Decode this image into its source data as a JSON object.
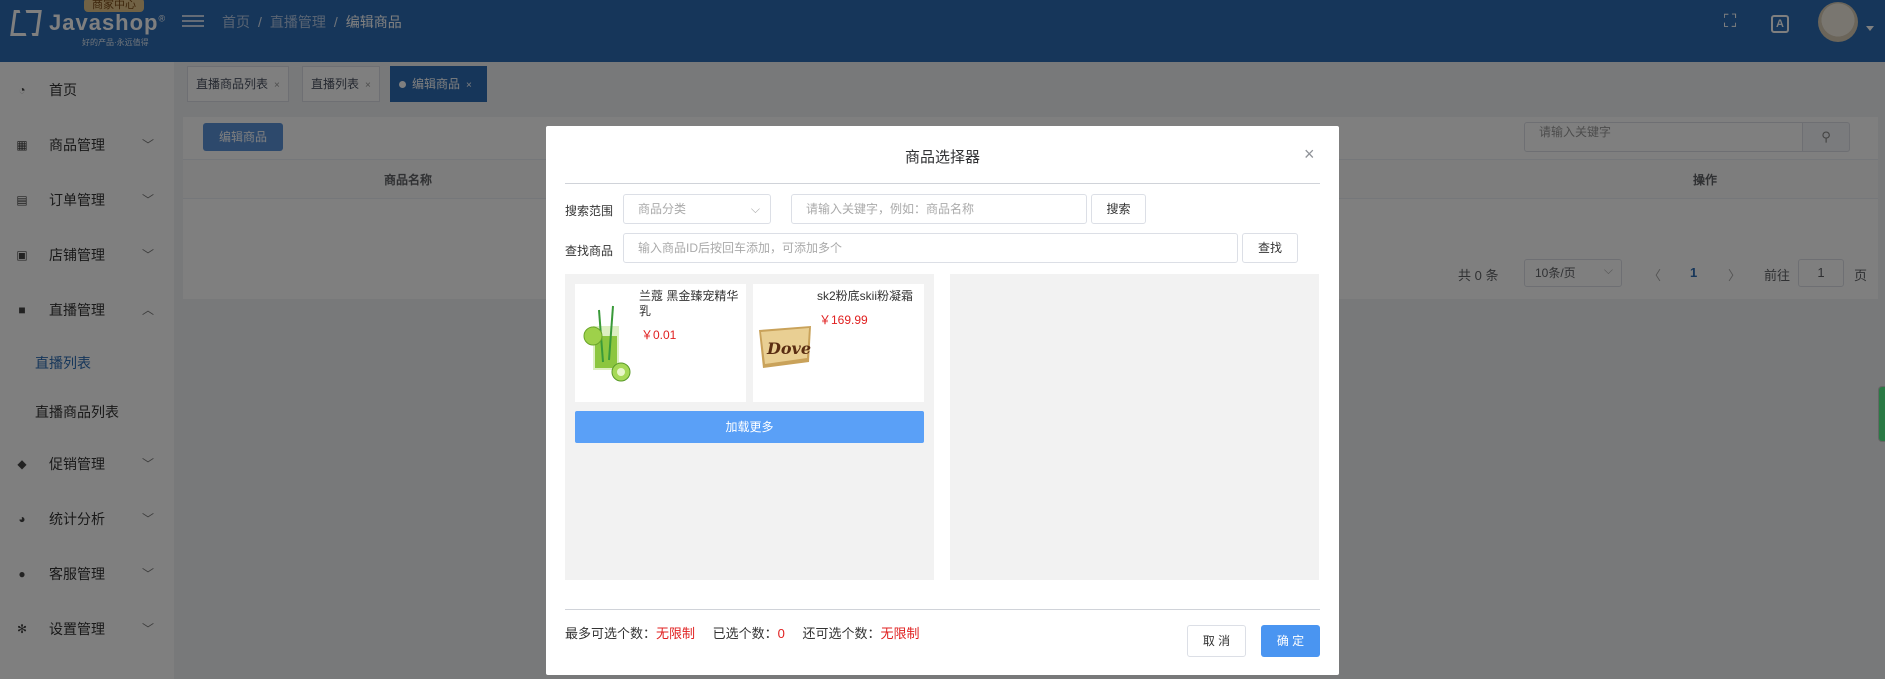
{
  "header": {
    "logo_badge": "商家中心",
    "logo_name": "Javashop",
    "logo_reg": "®",
    "logo_slogan": "好的产品·永远值得",
    "breadcrumb": [
      "首页",
      "直播管理",
      "编辑商品"
    ],
    "icons": [
      "menu-icon",
      "fullscreen-icon",
      "language-icon",
      "avatar"
    ]
  },
  "sidebar": {
    "items": [
      {
        "label": "首页",
        "icon": "dashboard-icon"
      },
      {
        "label": "商品管理",
        "icon": "grid-icon"
      },
      {
        "label": "订单管理",
        "icon": "clipboard-icon"
      },
      {
        "label": "店铺管理",
        "icon": "shop-icon"
      },
      {
        "label": "直播管理",
        "icon": "video-icon"
      },
      {
        "label": "促销管理",
        "icon": "tag-icon"
      },
      {
        "label": "统计分析",
        "icon": "pie-chart-icon"
      },
      {
        "label": "客服管理",
        "icon": "user-icon"
      },
      {
        "label": "设置管理",
        "icon": "gear-icon"
      }
    ],
    "subitems": [
      {
        "label": "直播列表",
        "active": true
      },
      {
        "label": "直播商品列表",
        "active": false
      }
    ]
  },
  "tabs": [
    {
      "label": "直播商品列表",
      "close": "×"
    },
    {
      "label": "直播列表",
      "close": "×"
    },
    {
      "label": "编辑商品",
      "close": "×",
      "active": true
    }
  ],
  "main": {
    "edit_button": "编辑商品",
    "search_placeholder": "请输入关键字",
    "columns": [
      "商品名称",
      "操作"
    ],
    "pager": {
      "total": "共 0 条",
      "page_size": "10条/页",
      "current_page": "1",
      "goto_prefix": "前往",
      "goto_value": "1",
      "goto_suffix": "页"
    }
  },
  "dialog": {
    "title": "商品选择器",
    "close": "×",
    "search_range_label": "搜索范围",
    "category_placeholder": "商品分类",
    "keyword_placeholder": "请输入关键字，例如：商品名称",
    "search_button": "搜索",
    "find_label": "查找商品",
    "find_placeholder": "输入商品ID后按回车添加，可添加多个",
    "find_button": "查找",
    "goods": [
      {
        "name": "兰蔻 黑金臻宠精华乳",
        "price": "￥0.01",
        "image": "mojito-drink-image"
      },
      {
        "name": "sk2粉底skii粉凝霜",
        "price": "￥169.99",
        "image": "dove-chocolate-image"
      }
    ],
    "load_more": "加载更多",
    "stats": {
      "max_label": "最多可选个数：",
      "max_value": "无限制",
      "selected_label": "已选个数：",
      "selected_value": "0",
      "remaining_label": "还可选个数：",
      "remaining_value": "无限制"
    },
    "cancel_button": "取 消",
    "ok_button": "确 定"
  }
}
